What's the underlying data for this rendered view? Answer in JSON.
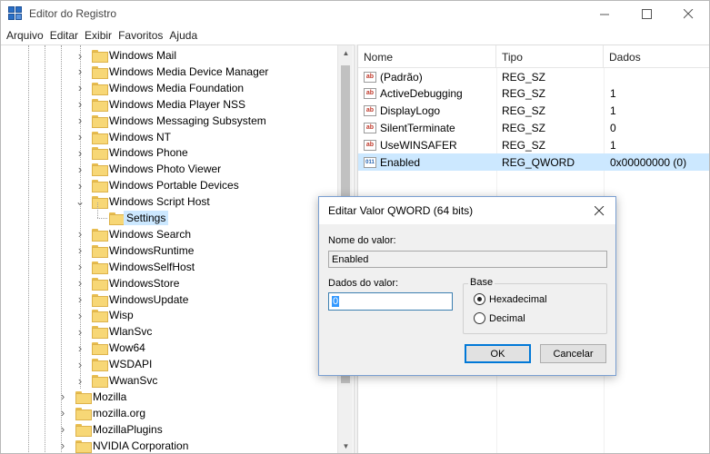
{
  "window": {
    "title": "Editor do Registro"
  },
  "menu": [
    "Arquivo",
    "Editar",
    "Exibir",
    "Favoritos",
    "Ajuda"
  ],
  "tree": {
    "items": [
      {
        "label": "Windows Mail",
        "level": 2,
        "expandable": true
      },
      {
        "label": "Windows Media Device Manager",
        "level": 2,
        "expandable": true
      },
      {
        "label": "Windows Media Foundation",
        "level": 2,
        "expandable": true
      },
      {
        "label": "Windows Media Player NSS",
        "level": 2,
        "expandable": true
      },
      {
        "label": "Windows Messaging Subsystem",
        "level": 2,
        "expandable": true
      },
      {
        "label": "Windows NT",
        "level": 2,
        "expandable": true
      },
      {
        "label": "Windows Phone",
        "level": 2,
        "expandable": true
      },
      {
        "label": "Windows Photo Viewer",
        "level": 2,
        "expandable": true
      },
      {
        "label": "Windows Portable Devices",
        "level": 2,
        "expandable": true
      },
      {
        "label": "Windows Script Host",
        "level": 2,
        "expandable": true,
        "expanded": true
      },
      {
        "label": "Settings",
        "level": 3,
        "expandable": false,
        "selected": true
      },
      {
        "label": "Windows Search",
        "level": 2,
        "expandable": true
      },
      {
        "label": "WindowsRuntime",
        "level": 2,
        "expandable": true
      },
      {
        "label": "WindowsSelfHost",
        "level": 2,
        "expandable": true
      },
      {
        "label": "WindowsStore",
        "level": 2,
        "expandable": true
      },
      {
        "label": "WindowsUpdate",
        "level": 2,
        "expandable": true
      },
      {
        "label": "Wisp",
        "level": 2,
        "expandable": true
      },
      {
        "label": "WlanSvc",
        "level": 2,
        "expandable": true
      },
      {
        "label": "Wow64",
        "level": 2,
        "expandable": true
      },
      {
        "label": "WSDAPI",
        "level": 2,
        "expandable": true
      },
      {
        "label": "WwanSvc",
        "level": 2,
        "expandable": true
      },
      {
        "label": "Mozilla",
        "level": 1,
        "expandable": true
      },
      {
        "label": "mozilla.org",
        "level": 1,
        "expandable": true
      },
      {
        "label": "MozillaPlugins",
        "level": 1,
        "expandable": true
      },
      {
        "label": "NVIDIA Corporation",
        "level": 1,
        "expandable": true
      }
    ]
  },
  "list": {
    "columns": {
      "name": "Nome",
      "type": "Tipo",
      "data": "Dados"
    },
    "rows": [
      {
        "icon": "string-value-icon",
        "name": "(Padrão)",
        "type": "REG_SZ",
        "data": ""
      },
      {
        "icon": "string-value-icon",
        "name": "ActiveDebugging",
        "type": "REG_SZ",
        "data": "1"
      },
      {
        "icon": "string-value-icon",
        "name": "DisplayLogo",
        "type": "REG_SZ",
        "data": "1"
      },
      {
        "icon": "string-value-icon",
        "name": "SilentTerminate",
        "type": "REG_SZ",
        "data": "0"
      },
      {
        "icon": "string-value-icon",
        "name": "UseWINSAFER",
        "type": "REG_SZ",
        "data": "1"
      },
      {
        "icon": "binary-value-icon",
        "name": "Enabled",
        "type": "REG_QWORD",
        "data": "0x00000000 (0)",
        "selected": true
      }
    ]
  },
  "dialog": {
    "title": "Editar Valor QWORD (64 bits)",
    "value_name_label": "Nome do valor:",
    "value_name": "Enabled",
    "value_data_label": "Dados do valor:",
    "value_data": "0",
    "base_label": "Base",
    "hex_label": "Hexadecimal",
    "dec_label": "Decimal",
    "base_selected": "Hexadecimal",
    "ok_label": "OK",
    "cancel_label": "Cancelar"
  }
}
